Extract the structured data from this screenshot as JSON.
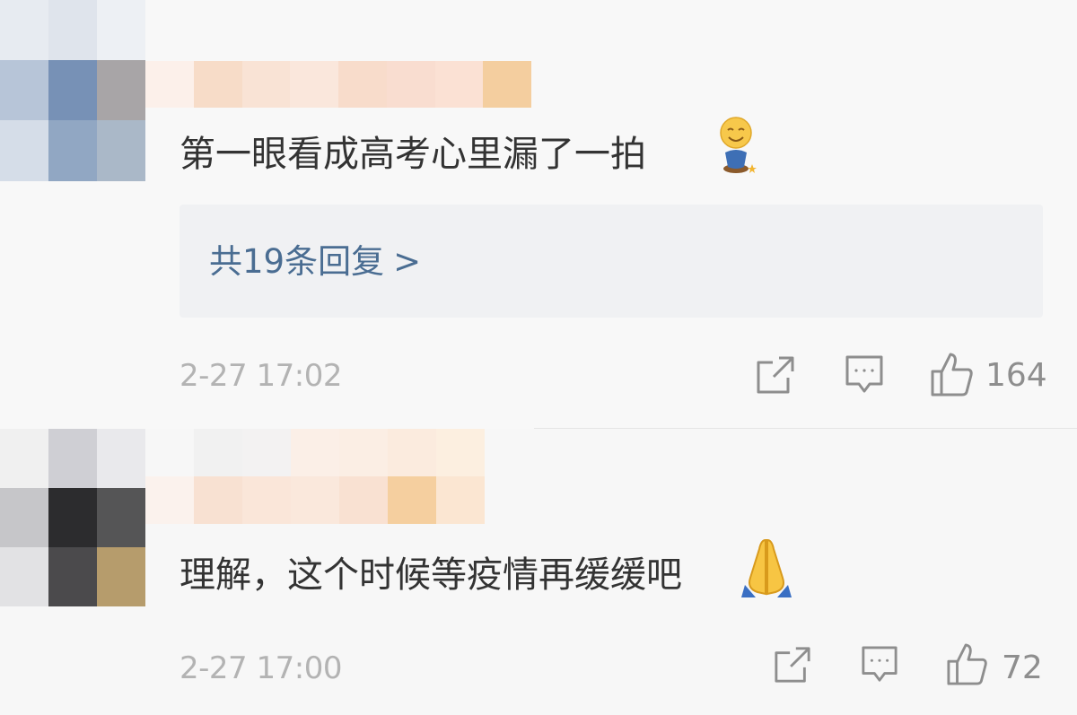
{
  "comments": [
    {
      "text": "第一眼看成高考心里漏了一拍",
      "emoji": "smiling-face-on-pot-emoji",
      "replies_label": "共19条回复",
      "replies_chevron": ">",
      "timestamp": "2-27 17:02",
      "likes": "164"
    },
    {
      "text": "理解，这个时候等疫情再缓缓吧",
      "emoji": "folded-hands-emoji",
      "timestamp": "2-27 17:00",
      "likes": "72"
    }
  ],
  "icons": {
    "share": "share-icon",
    "comment": "comment-icon",
    "like": "thumbs-up-icon"
  },
  "colors": {
    "text": "#333333",
    "link": "#4a6d92",
    "meta": "#b3b3b3",
    "icon": "#8e8e8e",
    "reply_bg": "#f0f1f3"
  }
}
